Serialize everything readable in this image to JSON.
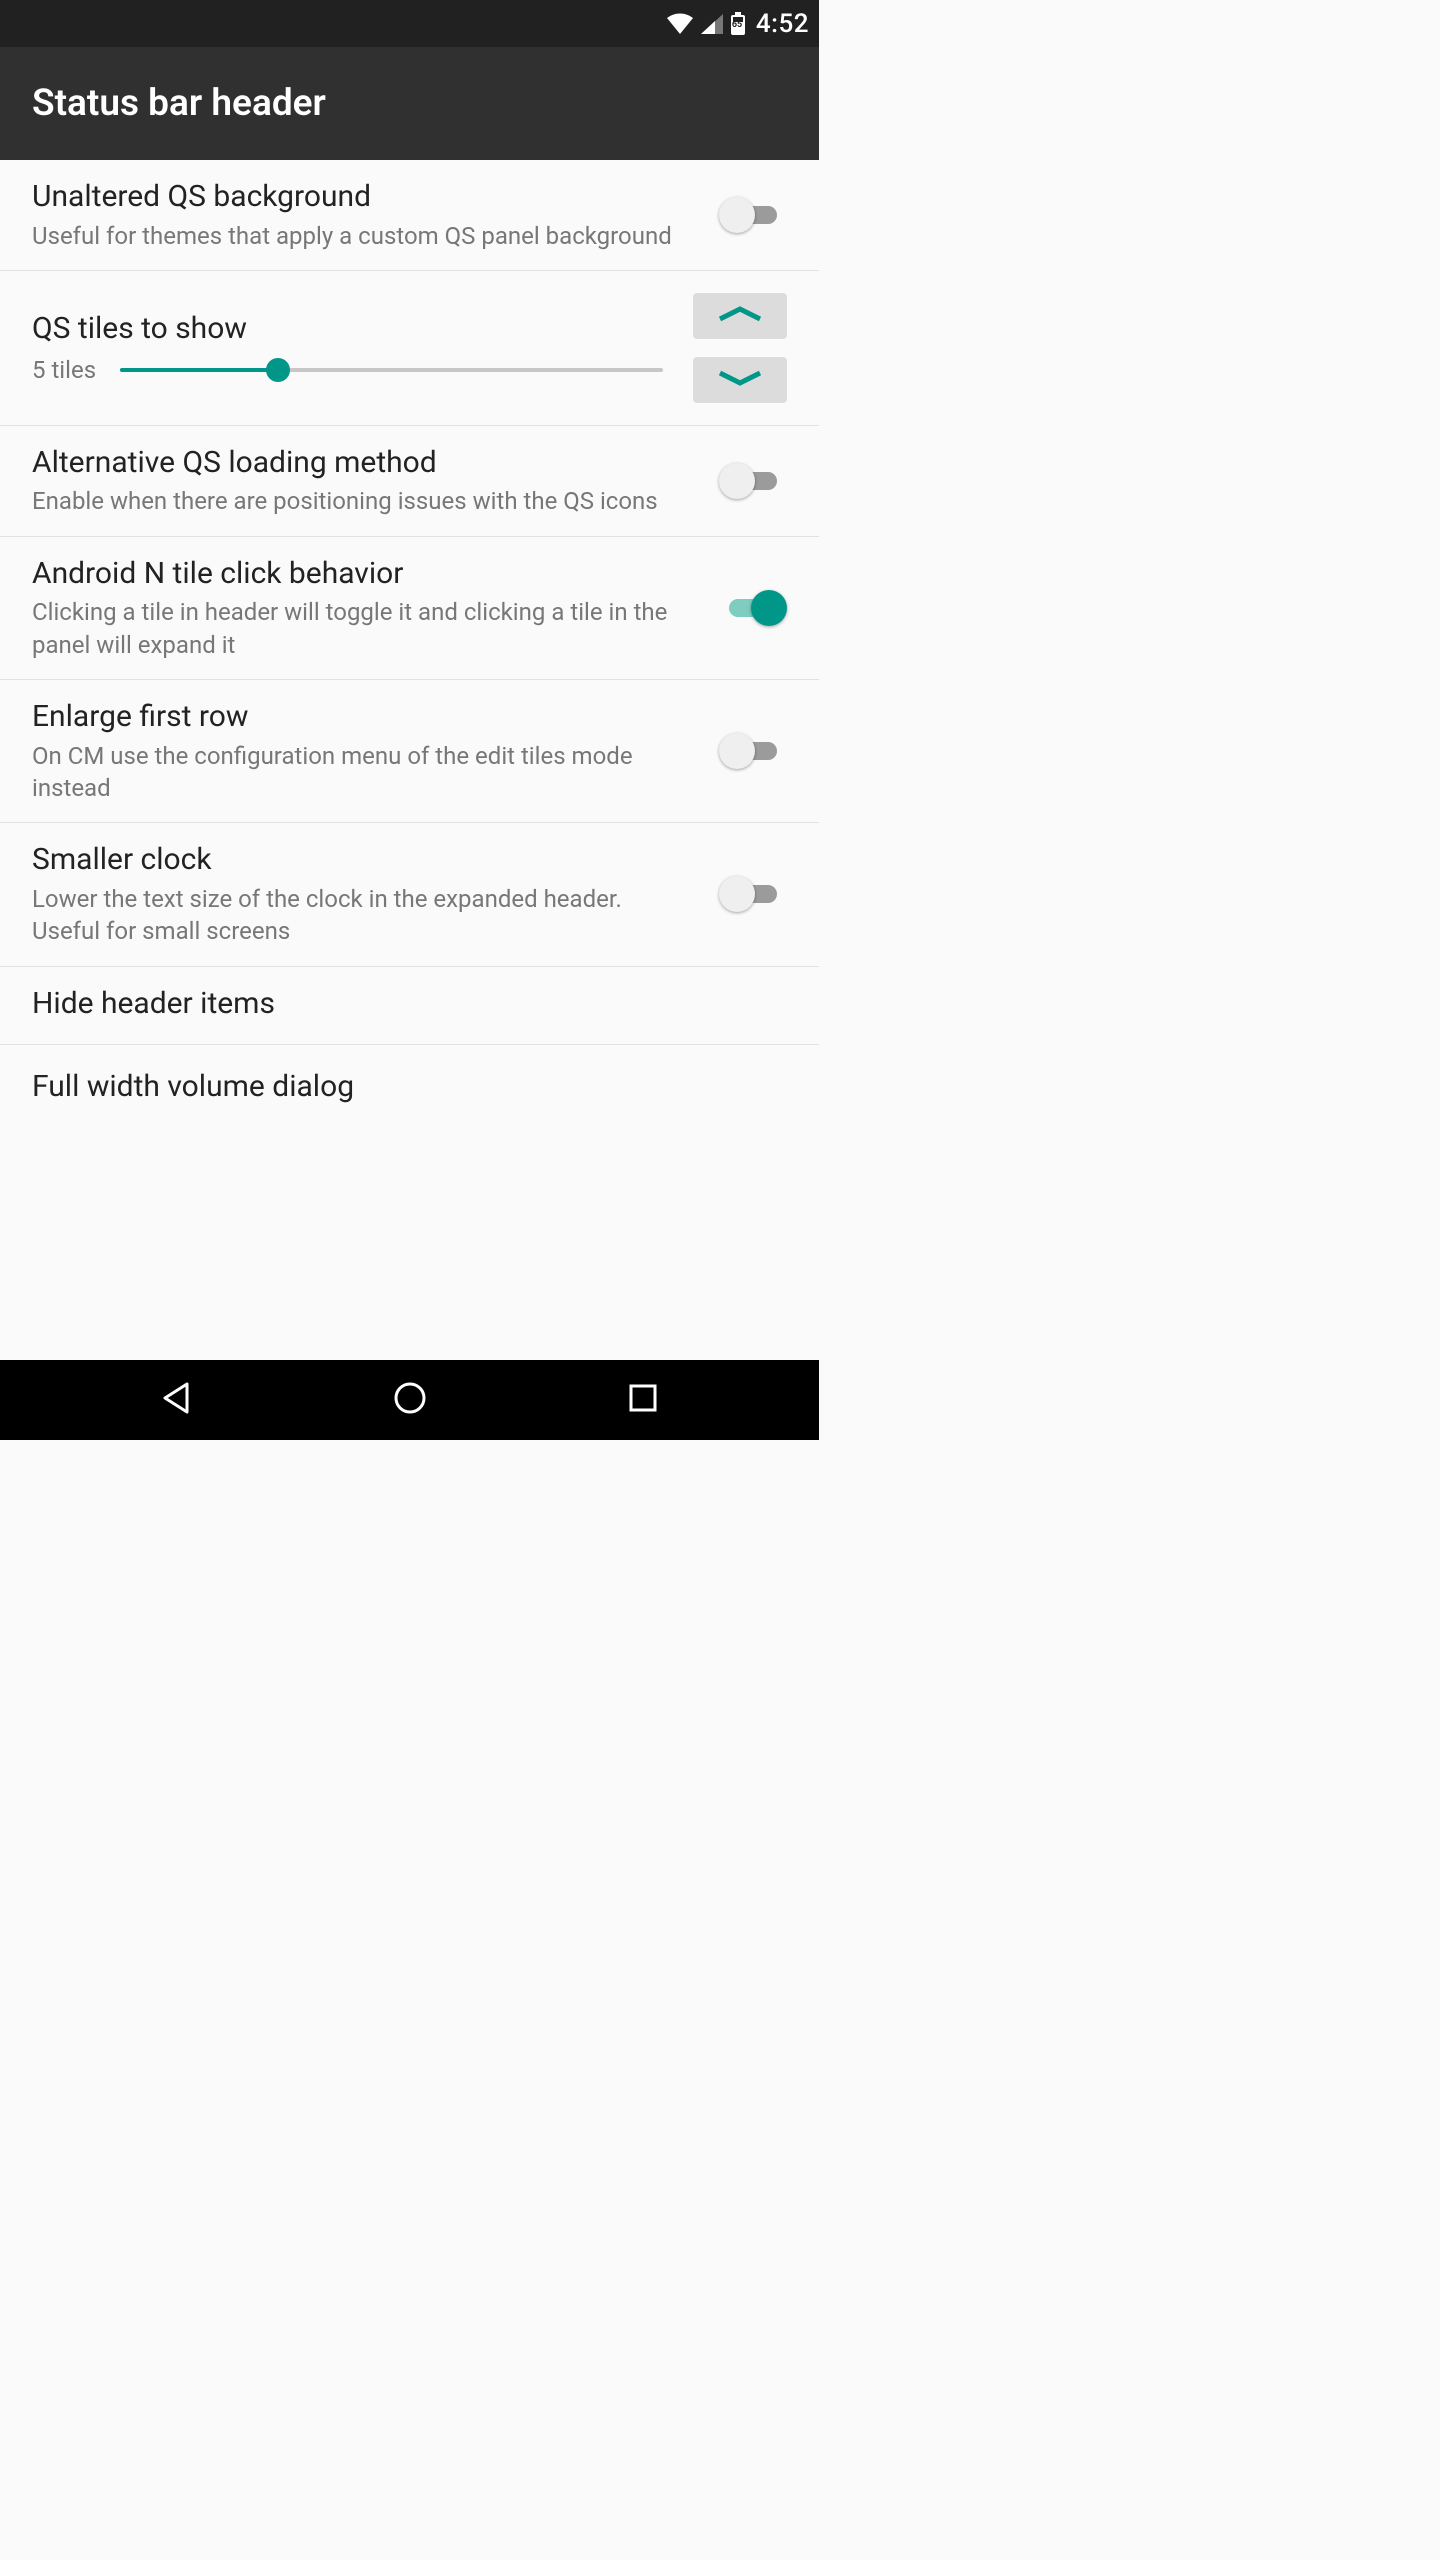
{
  "system": {
    "time": "4:52",
    "battery_level": "65"
  },
  "header": {
    "title": "Status bar header"
  },
  "settings": {
    "unaltered_bg": {
      "title": "Unaltered QS background",
      "subtitle": "Useful for themes that apply a custom QS panel background",
      "enabled": false
    },
    "qs_tiles": {
      "title": "QS tiles to show",
      "caption": "5 tiles",
      "value": 5,
      "min": 1,
      "max": 14,
      "fill_percent": 29
    },
    "alt_loading": {
      "title": "Alternative QS loading method",
      "subtitle": "Enable when there are positioning issues with the QS icons",
      "enabled": false
    },
    "n_click": {
      "title": "Android N tile click behavior",
      "subtitle": "Clicking a tile in header will toggle it and clicking a tile in the panel will expand it",
      "enabled": true
    },
    "enlarge_first": {
      "title": "Enlarge first row",
      "subtitle": "On CM use the configuration menu of the edit tiles mode instead",
      "enabled": false
    },
    "smaller_clock": {
      "title": "Smaller clock",
      "subtitle": "Lower the text size of the clock in the expanded header. Useful for small screens",
      "enabled": false
    },
    "hide_header": {
      "title": "Hide header items"
    },
    "full_width_vol": {
      "title": "Full width volume dialog"
    }
  }
}
